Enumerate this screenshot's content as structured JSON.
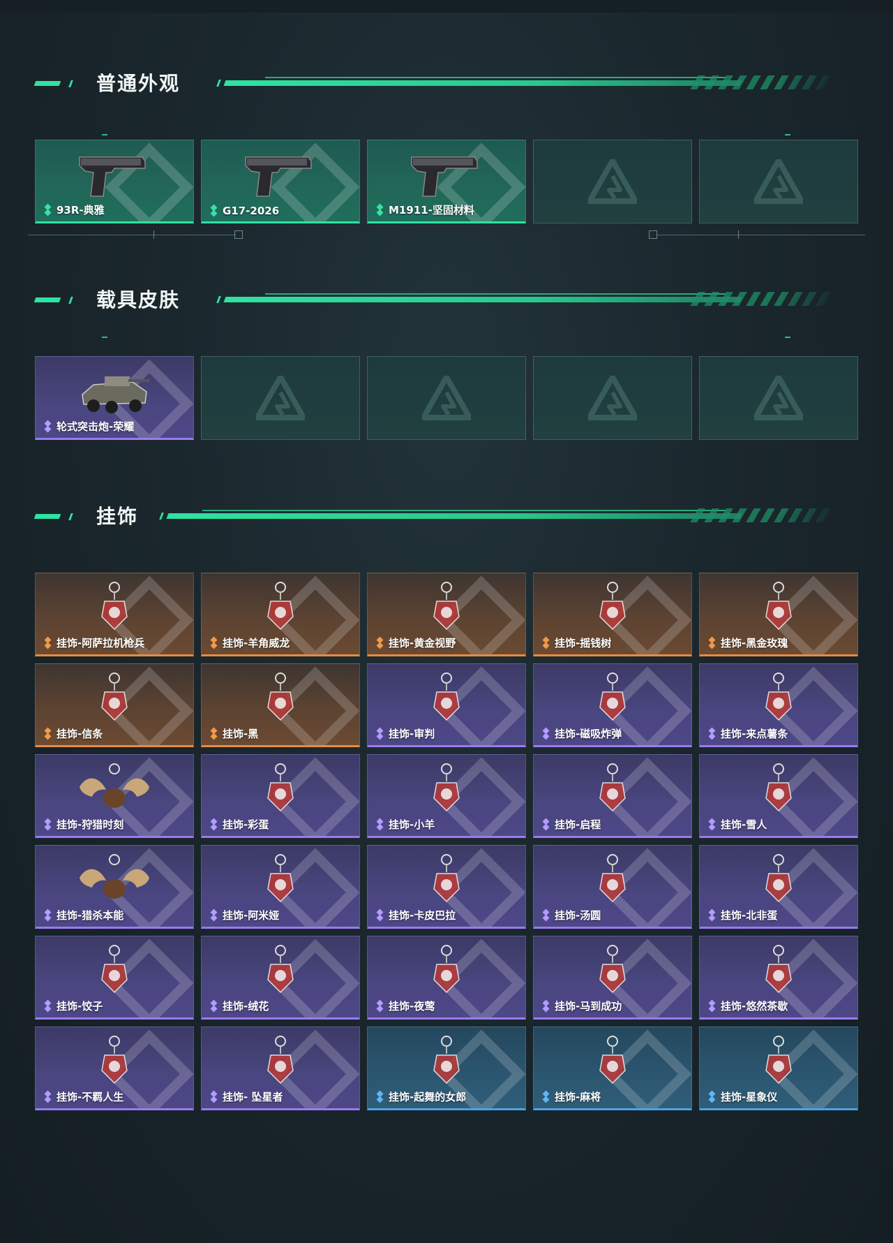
{
  "sections": [
    {
      "title": "普通外观",
      "items": [
        {
          "label": "93R-典雅",
          "rarity": "green",
          "icon": "pistol-93r-icon"
        },
        {
          "label": "G17-2026",
          "rarity": "green",
          "icon": "pistol-g17-icon"
        },
        {
          "label": "M1911-坚固材料",
          "rarity": "green",
          "icon": "pistol-m1911-icon"
        },
        {
          "label": "",
          "rarity": "empty",
          "icon": "empty-slot-logo-icon"
        },
        {
          "label": "",
          "rarity": "empty",
          "icon": "empty-slot-logo-icon"
        }
      ]
    },
    {
      "title": "载具皮肤",
      "items": [
        {
          "label": "轮式突击炮-荣耀",
          "rarity": "purple",
          "icon": "armored-vehicle-icon"
        },
        {
          "label": "",
          "rarity": "empty",
          "icon": "empty-slot-logo-icon"
        },
        {
          "label": "",
          "rarity": "empty",
          "icon": "empty-slot-logo-icon"
        },
        {
          "label": "",
          "rarity": "empty",
          "icon": "empty-slot-logo-icon"
        },
        {
          "label": "",
          "rarity": "empty",
          "icon": "empty-slot-logo-icon"
        }
      ]
    },
    {
      "title": "挂饰",
      "items": [
        {
          "label": "挂饰-阿萨拉机枪兵",
          "rarity": "orange",
          "icon": "charm-gunner-icon"
        },
        {
          "label": "挂饰-羊角威龙",
          "rarity": "orange",
          "icon": "charm-ram-icon"
        },
        {
          "label": "挂饰-黄金视野",
          "rarity": "orange",
          "icon": "charm-golden-vision-icon"
        },
        {
          "label": "挂饰-摇钱树",
          "rarity": "orange",
          "icon": "charm-money-tree-icon"
        },
        {
          "label": "挂饰-黑金玫瑰",
          "rarity": "orange",
          "icon": "charm-black-gold-rose-icon"
        },
        {
          "label": "挂饰-信条",
          "rarity": "orange",
          "icon": "charm-creed-icon"
        },
        {
          "label": "挂饰-黑",
          "rarity": "orange",
          "icon": "charm-black-tag-icon"
        },
        {
          "label": "挂饰-审判",
          "rarity": "purple",
          "icon": "charm-judgement-card-icon"
        },
        {
          "label": "挂饰-磁吸炸弹",
          "rarity": "purple",
          "icon": "charm-magnetic-bomb-icon"
        },
        {
          "label": "挂饰-来点薯条",
          "rarity": "purple",
          "icon": "charm-fries-icon"
        },
        {
          "label": "挂饰-狩猎时刻",
          "rarity": "purple",
          "icon": "charm-moose-antlers-icon"
        },
        {
          "label": "挂饰-彩蛋",
          "rarity": "purple",
          "icon": "charm-easter-egg-icon"
        },
        {
          "label": "挂饰-小羊",
          "rarity": "purple",
          "icon": "charm-lamb-icon"
        },
        {
          "label": "挂饰-启程",
          "rarity": "purple",
          "icon": "charm-ring-triangle-icon"
        },
        {
          "label": "挂饰-雪人",
          "rarity": "purple",
          "icon": "charm-snowman-icon"
        },
        {
          "label": "挂饰-猎杀本能",
          "rarity": "purple",
          "icon": "charm-moose-antlers-icon"
        },
        {
          "label": "挂饰-阿米娅",
          "rarity": "purple",
          "icon": "charm-amiya-icon"
        },
        {
          "label": "挂饰-卡皮巴拉",
          "rarity": "purple",
          "icon": "charm-capybara-icon"
        },
        {
          "label": "挂饰-汤圆",
          "rarity": "purple",
          "icon": "charm-tangyuan-icon"
        },
        {
          "label": "挂饰-北非蛋",
          "rarity": "purple",
          "icon": "charm-shakshuka-icon"
        },
        {
          "label": "挂饰-饺子",
          "rarity": "purple",
          "icon": "charm-dumpling-icon"
        },
        {
          "label": "挂饰-绒花",
          "rarity": "purple",
          "icon": "charm-velvet-flower-icon"
        },
        {
          "label": "挂饰-夜莺",
          "rarity": "purple",
          "icon": "charm-nightingale-icon"
        },
        {
          "label": "挂饰-马到成功",
          "rarity": "purple",
          "icon": "charm-red-horse-icon"
        },
        {
          "label": "挂饰-悠然茶歇",
          "rarity": "purple",
          "icon": "charm-cupcake-icon"
        },
        {
          "label": "挂饰-不羁人生",
          "rarity": "purple",
          "icon": "charm-sneaker-icon"
        },
        {
          "label": "挂饰- 坠星者",
          "rarity": "purple",
          "icon": "charm-triangle-pendant-icon"
        },
        {
          "label": "挂饰-起舞的女郎",
          "rarity": "blue",
          "icon": "charm-dancer-icon"
        },
        {
          "label": "挂饰-麻将",
          "rarity": "blue",
          "icon": "charm-mahjong-icon"
        },
        {
          "label": "挂饰-星象仪",
          "rarity": "blue",
          "icon": "charm-astrolabe-icon"
        }
      ]
    }
  ],
  "colors": {
    "accent": "#2fe3a0",
    "green": "#2fe3a0",
    "purple": "#9a7bf0",
    "orange": "#e88b40",
    "blue": "#4ca3e6"
  }
}
